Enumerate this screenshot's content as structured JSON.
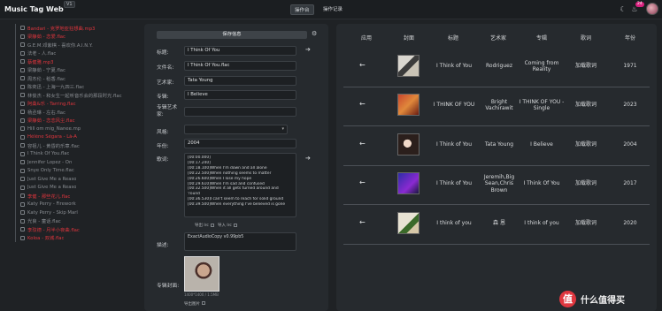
{
  "app": {
    "title": "Music Tag Web",
    "version": "V1"
  },
  "nav": {
    "items": [
      "操作台",
      "操作记录"
    ]
  },
  "topbar": {
    "notification_count": "24",
    "icons": [
      "moon-icon",
      "flame-icon",
      "user-avatar"
    ]
  },
  "files": [
    {
      "name": "Bandari - 克罗地亚狂想曲.mp3",
      "highlight": true
    },
    {
      "name": "梁静茹 - 恋爱.flac",
      "highlight": true
    },
    {
      "name": "G.E.M.邓紫棋 - 喜欢你.A.I.N.Y.",
      "highlight": false
    },
    {
      "name": "法老 - 人.flac",
      "highlight": false
    },
    {
      "name": "蔡健雅.mp3",
      "highlight": true
    },
    {
      "name": "梁静茹 - 宁夏.flac",
      "highlight": false
    },
    {
      "name": "周杰伦 - 稻香.flac",
      "highlight": false
    },
    {
      "name": "陈奕迅 - 上海一九四三.flac",
      "highlight": false
    },
    {
      "name": "林俊杰 - 和女生一起听音乐会的那段时光.flac",
      "highlight": false
    },
    {
      "name": "阿桑&乐 - Tarring.flac",
      "highlight": true
    },
    {
      "name": "杨丞琳 - 左右.flac",
      "highlight": false
    },
    {
      "name": "梁静茹 - 恋恋风尘.flac",
      "highlight": true
    },
    {
      "name": "Hill om mig_Nanee.mp",
      "highlight": false
    },
    {
      "name": "Hélène Ségara - Là-A",
      "highlight": true
    },
    {
      "name": "容祖儿 - 黄昏的乐章.flac",
      "highlight": false
    },
    {
      "name": "I Think Of You.flac",
      "highlight": false
    },
    {
      "name": "Jennifer Lopez - On",
      "highlight": false
    },
    {
      "name": "Snye Only Time.flac",
      "highlight": false
    },
    {
      "name": "Just Give Me a Reaso",
      "highlight": false
    },
    {
      "name": "Just Give Me a Reaso",
      "highlight": false
    },
    {
      "name": "李健 - 那些花儿.flac",
      "highlight": true
    },
    {
      "name": "Katy Perry - Firework",
      "highlight": false
    },
    {
      "name": "Katy Perry - Skip Marl",
      "highlight": false
    },
    {
      "name": "光良 - 童话.flac",
      "highlight": false
    },
    {
      "name": "李玟德 - 月半小夜曲.flac",
      "highlight": true
    },
    {
      "name": "Koloa - 双城.flac",
      "highlight": true
    }
  ],
  "editor": {
    "save_label": "保存信息",
    "labels": {
      "title": "标题:",
      "filename": "文件名:",
      "artist": "艺术家:",
      "album": "专辑:",
      "album_artist": "专辑艺术家:",
      "genre": "风格:",
      "year": "年份:",
      "lyrics": "歌词:",
      "description": "描述:",
      "cover": "专辑封面:"
    },
    "values": {
      "title": "I Think Of You",
      "filename": "I Think Of You.flac",
      "artist": "Tata Young",
      "album": "I Believe",
      "album_artist": "",
      "genre": "",
      "year": "2004",
      "description": "ExactAudioCopy v0.99pb5"
    },
    "lyrics": [
      "[00:00.000]",
      "[00:17.240]",
      "[00:18.100]When I'm down and all alone",
      "[00:22.500]When nothing seems to matter",
      "[00:26.600]When I lose my hope",
      "[00:29.610]When I'm sad and confused",
      "[00:32.500]When it all gets turned around and",
      "'round",
      "[00:36.530]I can't seem to reach for solid ground",
      "[00:39.500]When everything I've believed is gone"
    ],
    "lyric_options": [
      "导出 lrc",
      "导入 lrc"
    ],
    "cover_size": "1400*1400 / 1.5MB",
    "cover_option": "导出图片"
  },
  "results": {
    "columns": [
      "应用",
      "封面",
      "标题",
      "艺术家",
      "专辑",
      "歌词",
      "年份"
    ],
    "rows": [
      {
        "title": "I Think of You",
        "artist": "Rodriguez",
        "album": "Coming from Reality",
        "lyrics": "加载歌词",
        "year": "1971"
      },
      {
        "title": "I THINK OF YOU",
        "artist": "Bright Vachirawit",
        "album": "I THINK OF YOU - Single",
        "lyrics": "加载歌词",
        "year": "2023"
      },
      {
        "title": "I Think of You",
        "artist": "Tata Young",
        "album": "I Believe",
        "lyrics": "加载歌词",
        "year": "2004"
      },
      {
        "title": "I Think of You",
        "artist": "Jeremih,Big Sean,Chris Brown",
        "album": "I Think Of You",
        "lyrics": "加载歌词",
        "year": "2017"
      },
      {
        "title": "I think of you",
        "artist": "森 恩",
        "album": "I think of you",
        "lyrics": "加载歌词",
        "year": "2020"
      }
    ]
  },
  "watermark": {
    "logo": "值",
    "text": "什么值得买"
  }
}
